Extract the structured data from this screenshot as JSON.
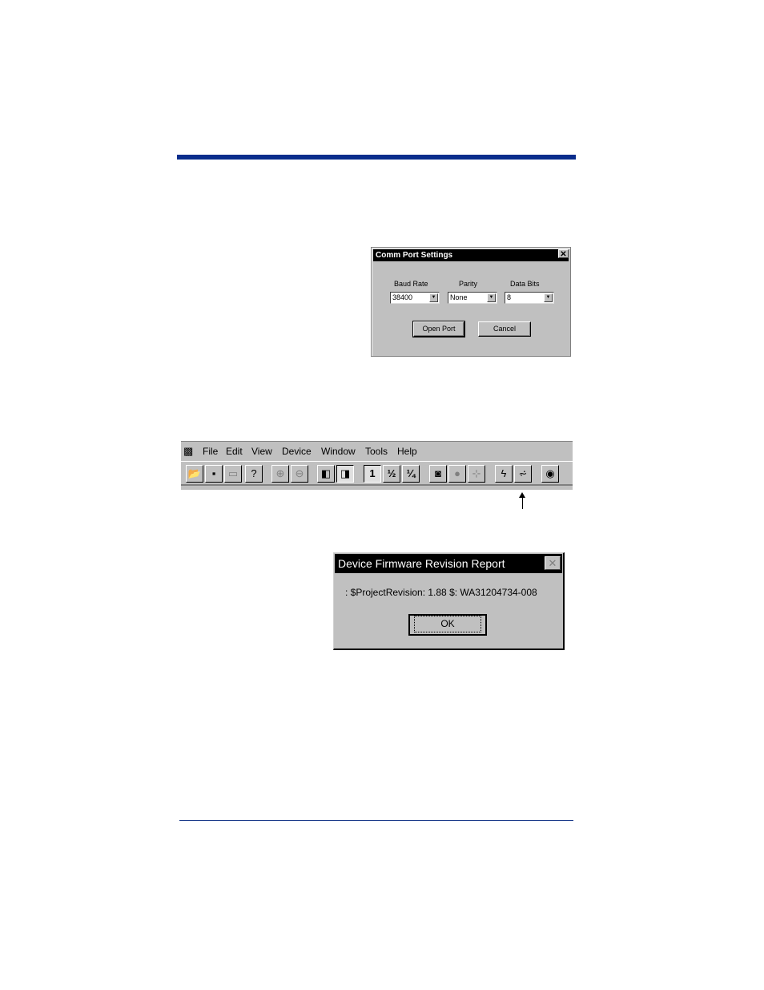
{
  "comm_dialog": {
    "title": "Comm Port Settings",
    "close_glyph": "✕",
    "baud_label": "Baud Rate",
    "baud_value": "38400",
    "parity_label": "Parity",
    "parity_value": "None",
    "databits_label": "Data Bits",
    "databits_value": "8",
    "open_port_label": "Open Port",
    "cancel_label": "Cancel"
  },
  "menubar": {
    "items": [
      "File",
      "Edit",
      "View",
      "Device",
      "Window",
      "Tools",
      "Help"
    ]
  },
  "toolbar": {
    "icons": [
      "open-folder-icon",
      "save-icon",
      "print-icon",
      "help-icon",
      "zoom-in-icon",
      "zoom-out-icon",
      "contrast-left-icon",
      "contrast-right-icon",
      "scale-1-icon",
      "scale-half-icon",
      "scale-quarter-icon",
      "camera-icon",
      "circle-icon",
      "crosshair-icon",
      "flash-icon",
      "firmware-icon",
      "viewer-icon"
    ],
    "scale_1": "1",
    "scale_half": "½",
    "scale_quarter": "¼"
  },
  "firmware_dialog": {
    "title": "Device Firmware Revision Report",
    "message": ": $ProjectRevision: 1.88 $: WA31204734-008",
    "ok_label": "OK",
    "close_glyph": "✕"
  },
  "colors": {
    "rule": "#0a2d8c",
    "dialog_face": "#c0c0c0"
  }
}
